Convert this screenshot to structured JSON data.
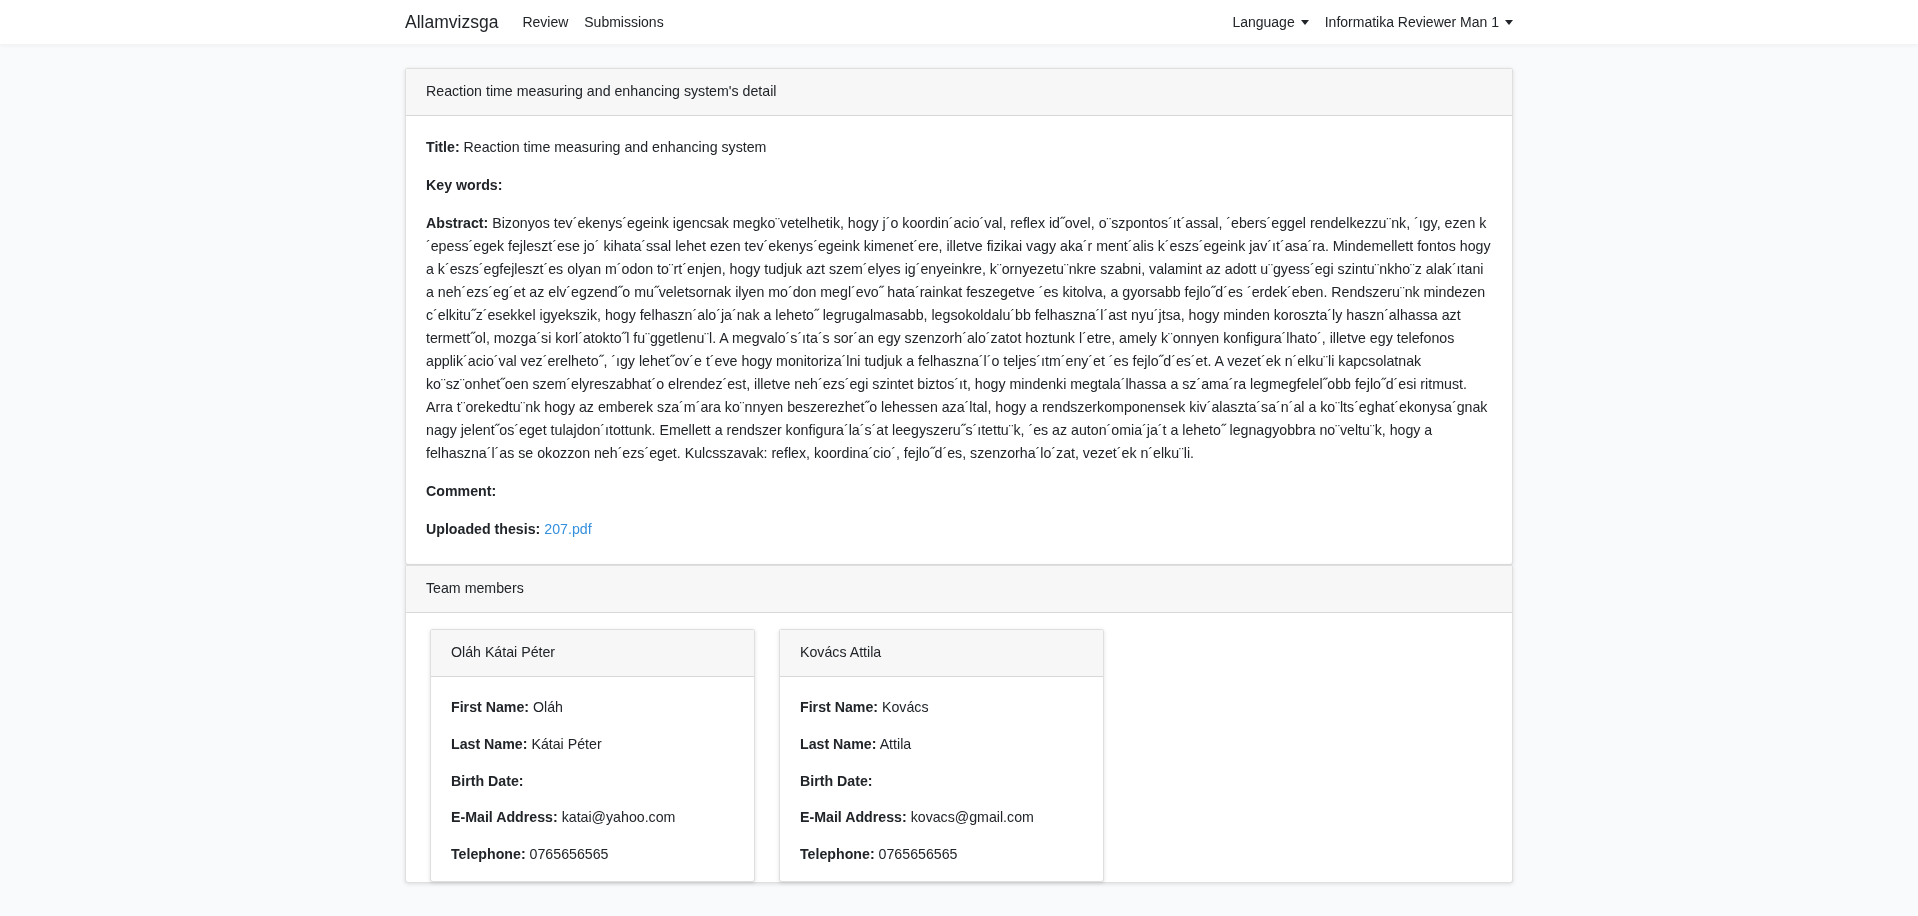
{
  "navbar": {
    "brand": "Allamvizsga",
    "links": [
      {
        "label": "Review"
      },
      {
        "label": "Submissions"
      }
    ],
    "dropdowns": [
      {
        "label": "Language"
      },
      {
        "label": "Informatika Reviewer Man 1"
      }
    ]
  },
  "detail": {
    "header": "Reaction time measuring and enhancing system's detail",
    "fields": [
      {
        "label": "Title:",
        "value": "Reaction time measuring and enhancing system"
      },
      {
        "label": "Key words:"
      },
      {
        "label": "Abstract:",
        "value": "Bizonyos tev´ekenys´egeink igencsak megko¨vetelhetik, hogy j´o koordin´acio´val, reflex id˝ovel, o¨szpontos´ıt´assal, ´ebers´eggel rendelkezzu¨nk, ´ıgy, ezen k ´epess´egek fejleszt´ese jo´ kihata´ssal lehet ezen tev´ekenys´egeink kimenet´ere, illetve fizikai vagy aka´r ment´alis k´eszs´egeink jav´ıt´asa´ra. Mindemellett fontos hogy a k´eszs´egfejleszt´es olyan m´odon to¨rt´enjen, hogy tudjuk azt szem´elyes ig´enyeinkre, k¨ornyezetu¨nkre szabni, valamint az adott u¨gyess´egi szintu¨nkho¨z alak´ıtani a neh´ezs´eg´et az elv´egzend˝o mu˝veletsornak ilyen mo´don megl´evo˝ hata´rainkat feszegetve ´es kitolva, a gyorsabb fejlo˝d´es ´erdek´eben. Rendszeru¨nk mindezen c´elkitu˝z´esekkel igyekszik, hogy felhaszn´alo´ja´nak a leheto˝ legrugalmasabb, legsokoldalu´bb felhaszna´l´ast nyu´jtsa, hogy minden koroszta´ly haszn´alhassa azt termett˝ol, mozga´si korl´atokto˝l fu¨ggetlenu¨l. A megvalo´s´ıta´s sor´an egy szenzorh´alo´zatot hoztunk l´etre, amely k¨onnyen konfigura´lhato´, illetve egy telefonos applik´acio´val vez´erelheto˝, ´ıgy lehet˝ov´e t´eve hogy monitoriza´lni tudjuk a felhaszna´l´o teljes´ıtm´eny´et ´es fejlo˝d´es´et. A vezet´ek n´elku¨li kapcsolatnak ko¨sz¨onhet˝oen szem´elyreszabhat´o elrendez´est, illetve neh´ezs´egi szintet biztos´ıt, hogy mindenki megtala´lhassa a sz´ama´ra legmegfelel˝obb fejlo˝d´esi ritmust. Arra t¨orekedtu¨nk hogy az emberek sza´m´ara ko¨nnyen beszerezhet˝o lehessen aza´ltal, hogy a rendszerkomponensek kiv´alaszta´sa´n´al a ko¨lts´eghat´ekonysa´gnak nagy jelent˝os´eget tulajdon´ıtottunk. Emellett a rendszer konfigura´la´s´at leegyszeru˝s´ıtettu¨k, ´es az auton´omia´ja´t a leheto˝ legnagyobbra no¨veltu¨k, hogy a felhaszna´l´as se okozzon neh´ezs´eget. Kulcsszavak: reflex, koordina´cio´, fejlo˝d´es, szenzorha´lo´zat, vezet´ek n´elku¨li."
      },
      {
        "label": "Comment:"
      },
      {
        "label": "Uploaded thesis:",
        "link": "207.pdf"
      }
    ]
  },
  "team": {
    "header": "Team members",
    "members": [
      {
        "name": "Oláh Kátai Péter",
        "fields": [
          {
            "label": "First Name:",
            "value": "Oláh"
          },
          {
            "label": "Last Name:",
            "value": "Kátai Péter"
          },
          {
            "label": "Birth Date:"
          },
          {
            "label": "E-Mail Address:",
            "value": "katai@yahoo.com"
          },
          {
            "label": "Telephone:",
            "value": "0765656565"
          }
        ]
      },
      {
        "name": "Kovács Attila",
        "fields": [
          {
            "label": "First Name:",
            "value": "Kovács"
          },
          {
            "label": "Last Name:",
            "value": "Attila"
          },
          {
            "label": "Birth Date:"
          },
          {
            "label": "E-Mail Address:",
            "value": "kovacs@gmail.com"
          },
          {
            "label": "Telephone:",
            "value": "0765656565"
          }
        ]
      }
    ]
  }
}
